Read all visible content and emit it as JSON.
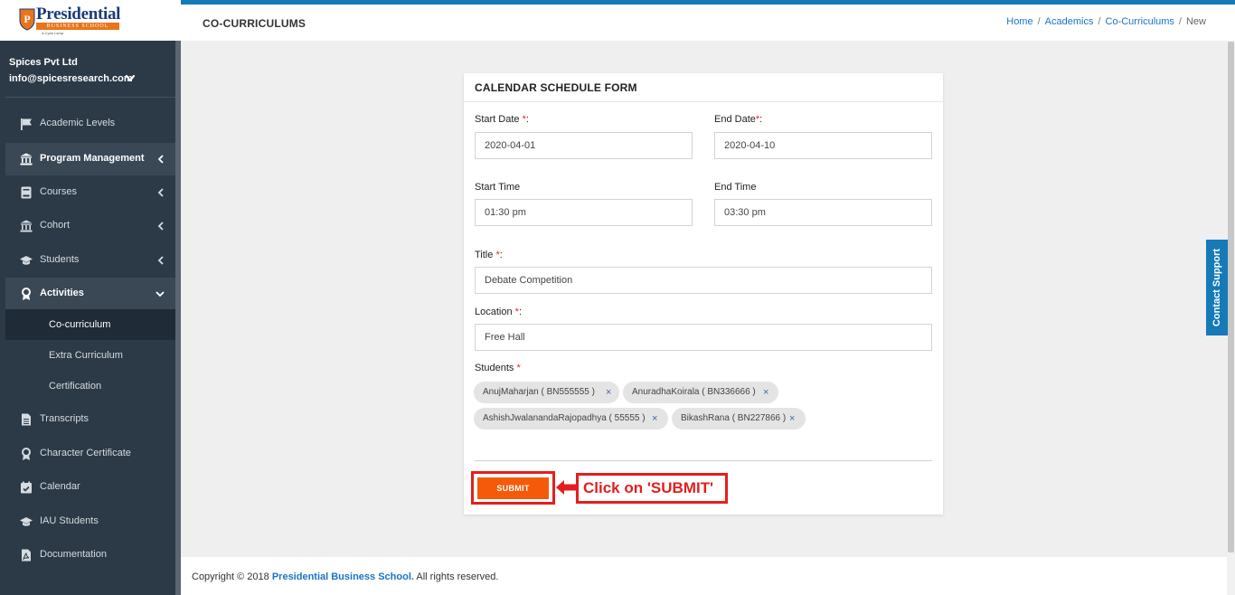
{
  "brand": {
    "logo_name": "Presidential",
    "logo_sub": "BUSINESS SCHOOL",
    "logo_tagline": "A Cyan Lamp",
    "accent": "#1679b8",
    "submit_color": "#f55a0a",
    "annotation_color": "#e41e1e"
  },
  "user": {
    "name": "Spices Pvt Ltd",
    "email": "info@spicesresearch.com",
    "menu_icon": "chevron-down-icon"
  },
  "sidebar": {
    "items": [
      {
        "label": "Academic Levels",
        "icon": "flag-icon"
      },
      {
        "label": "Program Management",
        "icon": "institution-icon",
        "caret": "chevron-left-icon"
      },
      {
        "label": "Courses",
        "icon": "book-icon",
        "caret": "chevron-left-icon"
      },
      {
        "label": "Cohort",
        "icon": "institution-icon",
        "caret": "chevron-left-icon"
      },
      {
        "label": "Students",
        "icon": "graduation-cap-icon",
        "caret": "chevron-left-icon"
      },
      {
        "label": "Activities",
        "icon": "award-icon",
        "caret": "chevron-down-icon"
      },
      {
        "label": "Co-curriculum"
      },
      {
        "label": "Extra Curriculum"
      },
      {
        "label": "Certification"
      },
      {
        "label": "Transcripts",
        "icon": "document-icon"
      },
      {
        "label": "Character Certificate",
        "icon": "award-icon"
      },
      {
        "label": "Calendar",
        "icon": "calendar-check-icon"
      },
      {
        "label": "IAU Students",
        "icon": "graduation-cap-icon"
      },
      {
        "label": "Documentation",
        "icon": "pdf-document-icon"
      }
    ]
  },
  "header": {
    "title": "CO-CURRICULUMS",
    "breadcrumb": [
      "Home",
      "Academics",
      "Co-Curriculums",
      "New"
    ],
    "separator": "/"
  },
  "form": {
    "title": "CALENDAR SCHEDULE FORM",
    "start_date": {
      "label": "Start Date ",
      "required": "*",
      "suffix": ":",
      "value": "2020-04-01"
    },
    "end_date": {
      "label": "End Date",
      "required": "*",
      "suffix": ":",
      "value": "2020-04-10"
    },
    "start_time": {
      "label": "Start Time",
      "value": "01:30 pm"
    },
    "end_time": {
      "label": "End Time",
      "value": "03:30 pm"
    },
    "title_field": {
      "label": "Title ",
      "required": "*",
      "suffix": ":",
      "value": "Debate Competition"
    },
    "location": {
      "label": "Location ",
      "required": "*",
      "suffix": ":",
      "value": "Free Hall"
    },
    "students": {
      "label": "Students ",
      "required": "*",
      "selected": [
        "AnujMaharjan ( BN555555 )",
        "AnuradhaKoirala ( BN336666 )",
        "AshishJwalanandaRajopadhya ( 55555 )",
        "BikashRana ( BN227866 )"
      ],
      "remove_symbol": "×"
    },
    "submit_label": "SUBMIT"
  },
  "annotation": {
    "text": "Click on 'SUBMIT'"
  },
  "contact_support": "Contact Support",
  "footer": {
    "prefix": "Copyright © 2018 ",
    "link": "Presidential Business School.",
    "suffix": " All rights reserved."
  }
}
